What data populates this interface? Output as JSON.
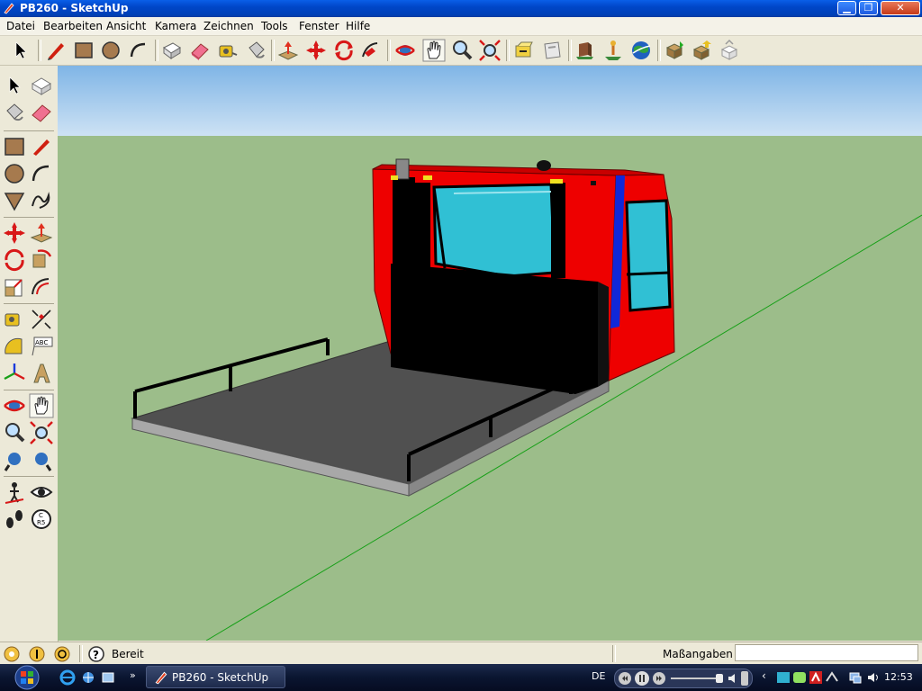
{
  "window": {
    "title": "PB260 - SketchUp",
    "min_glyph": "▁",
    "max_glyph": "❐",
    "close_glyph": "✕"
  },
  "menu": {
    "items": [
      "Datei",
      "Bearbeiten",
      "Ansicht",
      "Kamera",
      "Zeichnen",
      "Tools",
      "Fenster",
      "Hilfe"
    ]
  },
  "toolbar_icons": [
    "select-icon",
    "pencil-line-icon",
    "rectangle-icon",
    "circle-icon",
    "arc-icon",
    "make-component-icon",
    "eraser-icon",
    "tape-measure-icon",
    "paint-bucket-icon",
    "push-pull-icon",
    "move-icon",
    "rotate-icon",
    "follow-me-icon",
    "orbit-icon",
    "pan-icon",
    "zoom-icon",
    "zoom-extents-icon",
    "previous-view-icon",
    "next-view-icon",
    "3d-warehouse-icon",
    "place-model-icon",
    "google-earth-icon",
    "get-models-icon",
    "share-model-icon",
    "component-icon"
  ],
  "status": {
    "text": "Bereit",
    "measurements_label": "Maßangaben",
    "measurements_value": ""
  },
  "taskbar": {
    "app_label": "PB260 - SketchUp",
    "language": "DE",
    "clock": "12:53"
  },
  "colors": {
    "sky_top": "#7fb5e6",
    "sky_bottom": "#cde2f4",
    "ground": "#9cbd8a",
    "cab_red": "#ee0000",
    "glass": "#30c0d4",
    "bed_gray": "#505050",
    "axis_green": "#18a018",
    "trim_blue": "#1028d8"
  }
}
